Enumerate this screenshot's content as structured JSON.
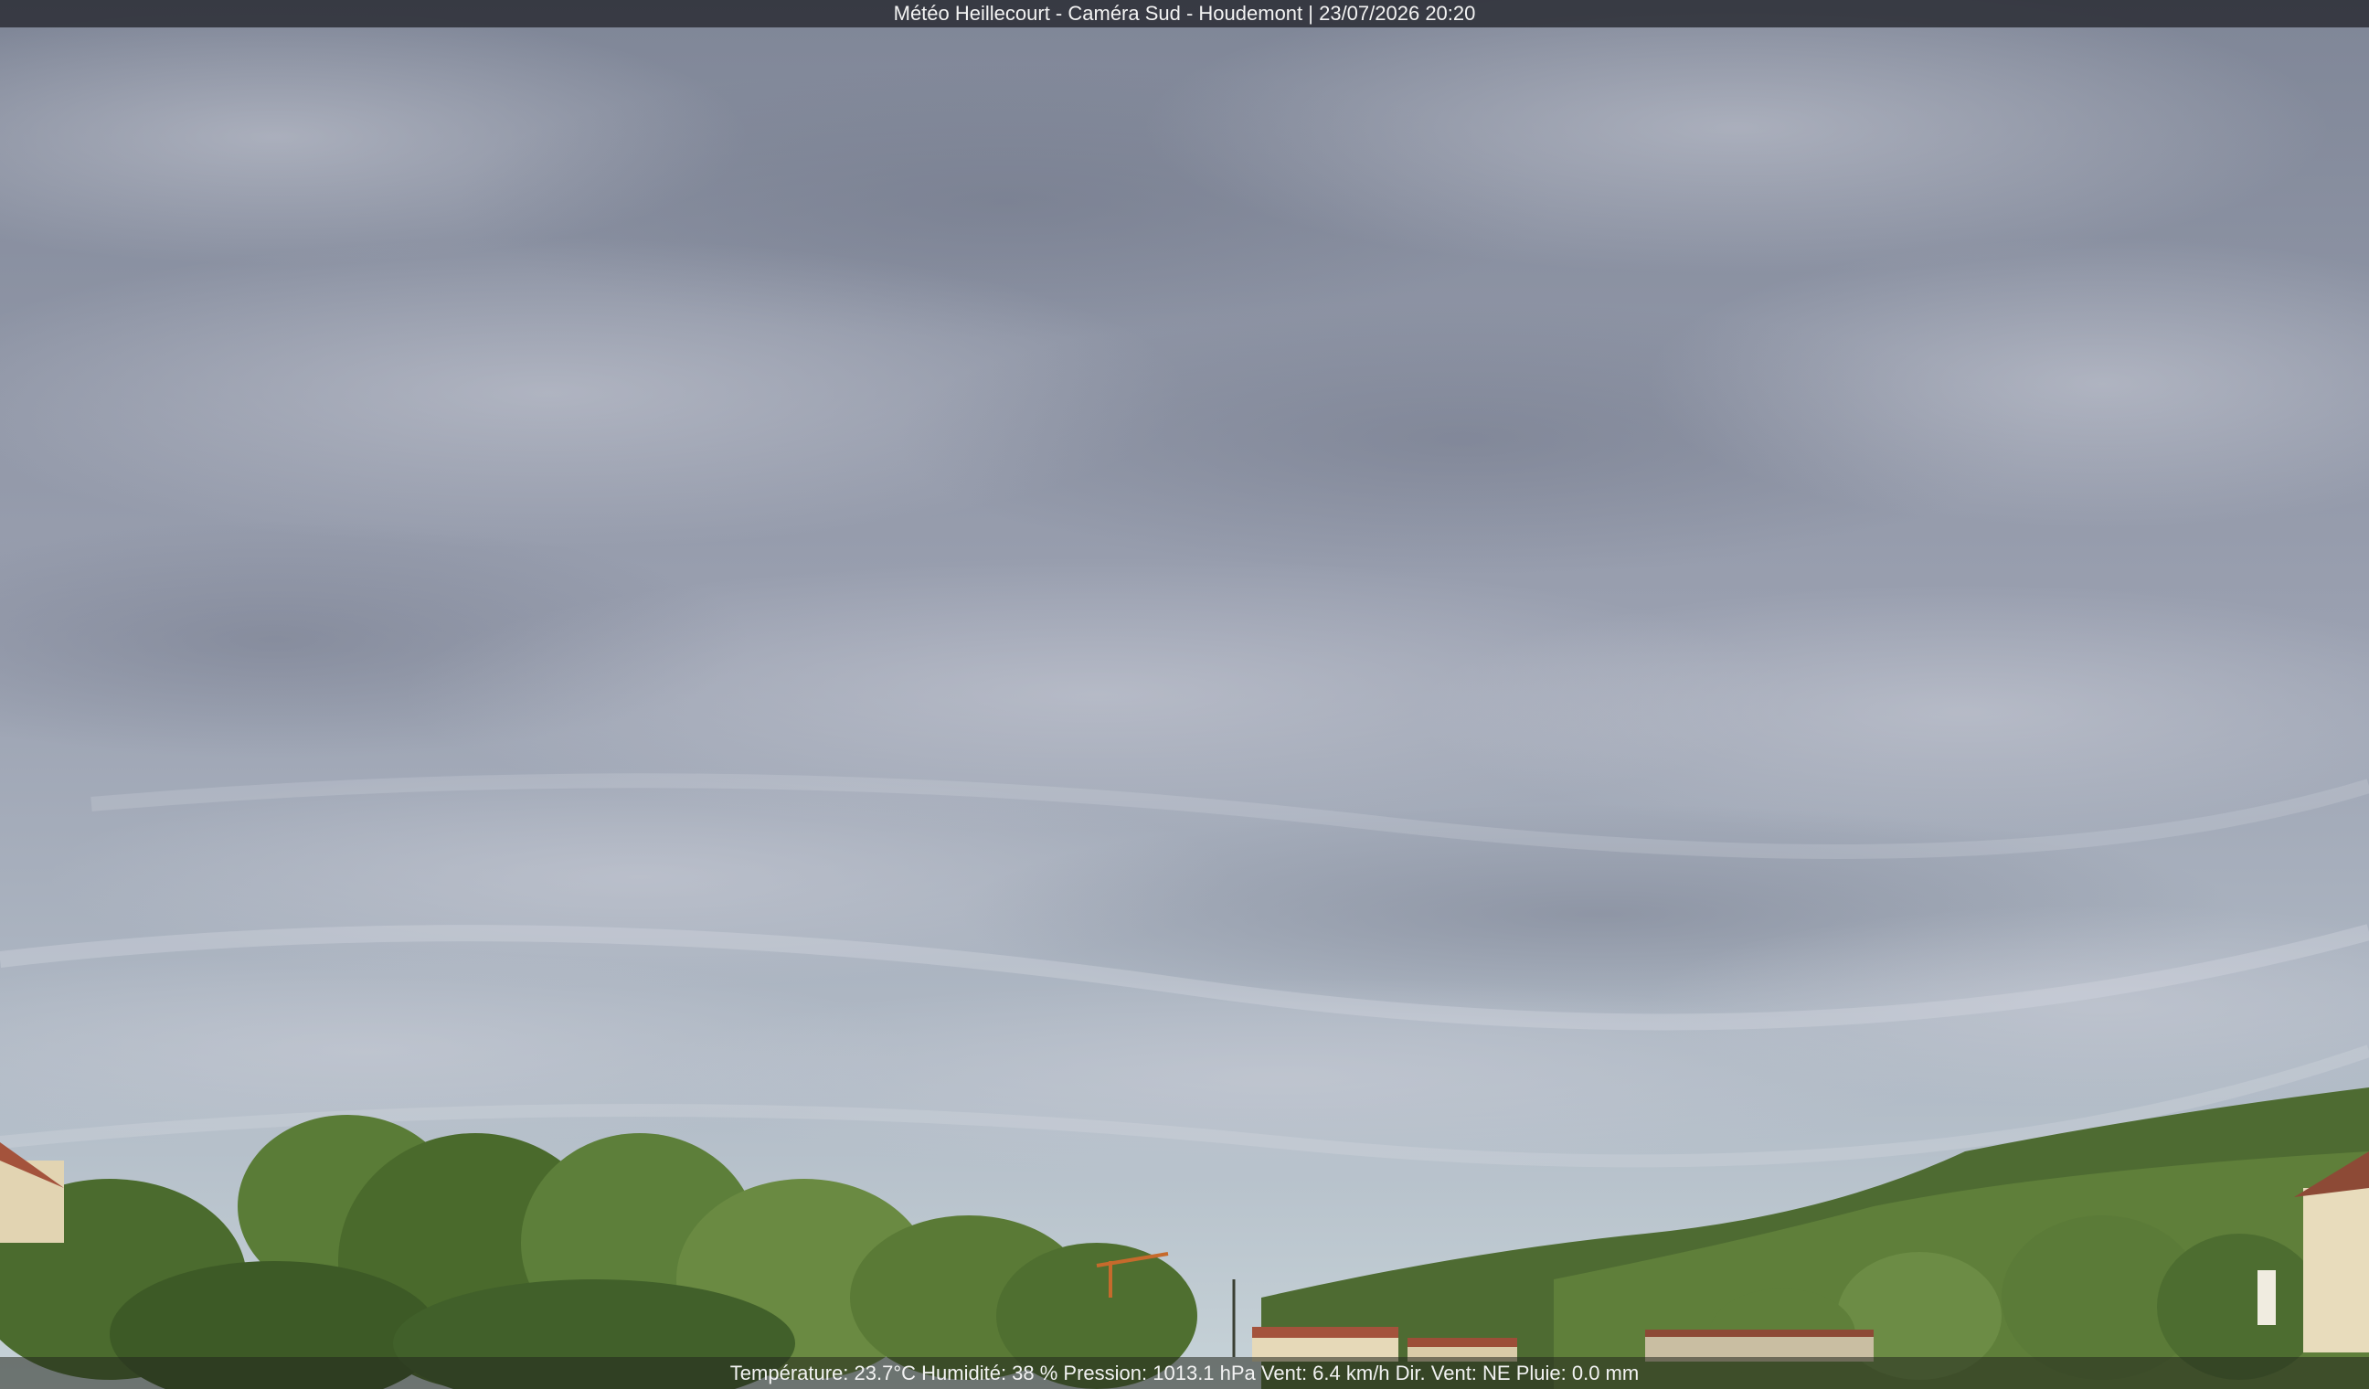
{
  "overlay": {
    "title": "Météo Heillecourt - Caméra Sud - Houdemont | 23/07/2026 20:20",
    "readings": "Température: 23.7°C  Humidité: 38 % Pression: 1013.1 hPa Vent: 6.4 km/h Dir. Vent: NE Pluie: 0.0 mm"
  },
  "scene": {
    "sky_top": "#7f8697",
    "sky_mid": "#a0a6b6",
    "sky_horizon": "#c3cfd6",
    "tree_dark": "#3d5a2a",
    "tree_mid": "#5f7f3a",
    "tree_light": "#8aa458",
    "roof": "#a4533c",
    "wall": "#e6d9b8"
  }
}
